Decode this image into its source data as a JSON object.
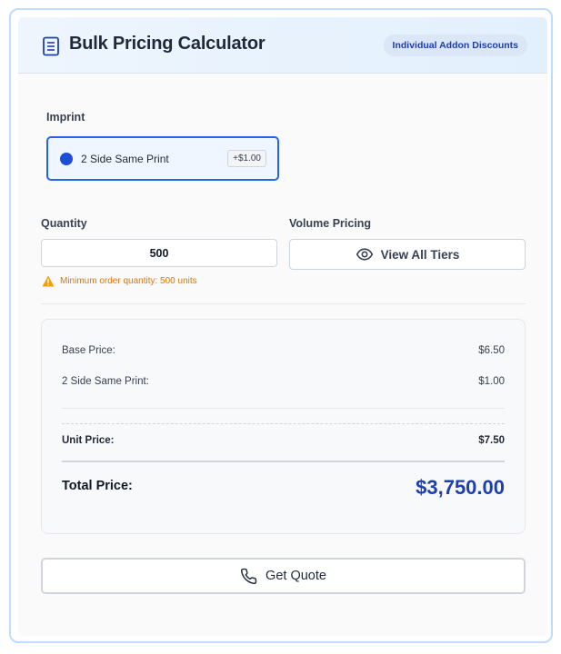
{
  "header": {
    "title": "Bulk Pricing Calculator",
    "badge": "Individual Addon Discounts",
    "icon": "document-icon"
  },
  "imprint": {
    "label": "Imprint",
    "selected_option": "2 Side Same Print",
    "option_addon": "+$1.00"
  },
  "quantity": {
    "label": "Quantity",
    "value": "500",
    "warning": "Minimum order quantity: 500 units"
  },
  "volume_pricing": {
    "label": "Volume Pricing",
    "button_label": "View All Tiers",
    "icon": "eye-icon"
  },
  "summary": {
    "base_label": "Base Price:",
    "base_value": "$6.50",
    "addon_label": "2 Side Same Print:",
    "addon_value": "$1.00",
    "unit_label": "Unit Price:",
    "unit_value": "$7.50",
    "total_label": "Total Price:",
    "total_value": "$3,750.00"
  },
  "actions": {
    "quote_label": "Get Quote",
    "quote_icon": "phone-icon"
  },
  "colors": {
    "accent": "#2563eb",
    "total": "#1e40af",
    "warning": "#d97706"
  }
}
